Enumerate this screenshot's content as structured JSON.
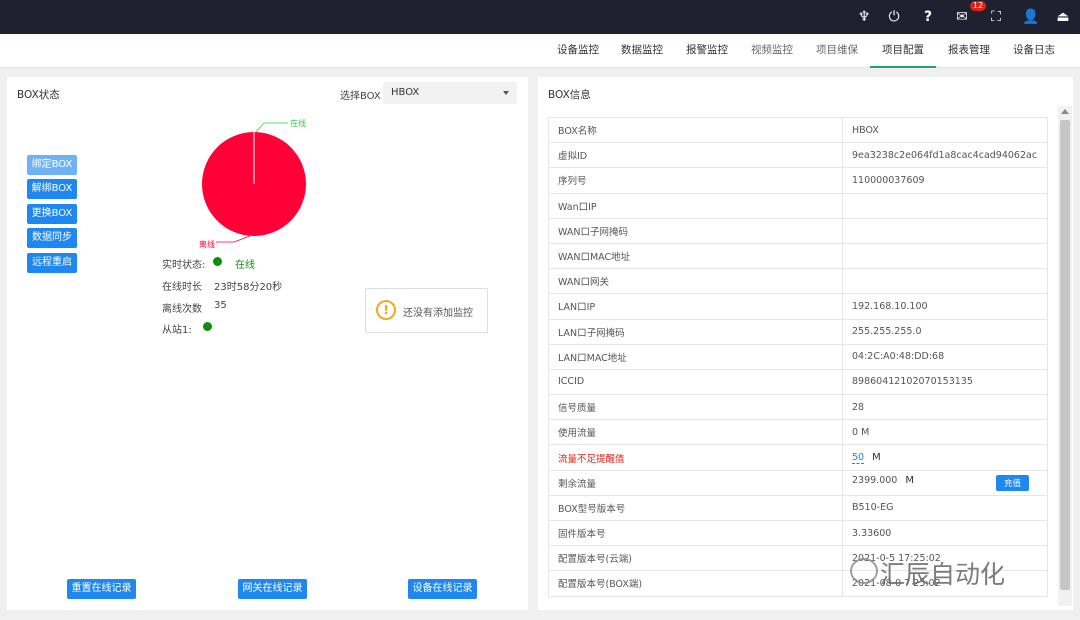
{
  "topbar": {
    "icons": [
      "monitor-alarm-icon",
      "power-icon",
      "help-icon",
      "mail-icon",
      "fullscreen-icon",
      "user-icon",
      "logout-icon"
    ],
    "mail_badge": "12"
  },
  "nav": {
    "items": [
      {
        "label": "设备监控"
      },
      {
        "label": "数据监控"
      },
      {
        "label": "报警监控"
      },
      {
        "label": "视频监控"
      },
      {
        "label": "项目维保"
      },
      {
        "label": "项目配置"
      },
      {
        "label": "报表管理"
      },
      {
        "label": "设备日志"
      }
    ],
    "active": "项目配置",
    "active_color": "#1aa56a"
  },
  "left_panel": {
    "title": "BOX状态",
    "select_label": "选择BOX",
    "select_value": "HBOX",
    "actions": [
      "绑定BOX",
      "解绑BOX",
      "更换BOX",
      "数据同步",
      "远程重启"
    ],
    "pie": {
      "online_label": "在线",
      "offline_label": "离线",
      "online_value": 0,
      "offline_value": 1,
      "online_color": "#2ecc40",
      "offline_color": "#ff0037"
    },
    "status": {
      "realtime_label": "实时状态:",
      "realtime_value": "在线",
      "duration_label": "在线时长",
      "duration_value": "23时58分20秒",
      "offline_count_label": "离线次数",
      "offline_count_value": "35",
      "slave_label": "从站1:"
    },
    "empty_monitor_text": "还没有添加监控",
    "bottom_buttons": [
      "重置在线记录",
      "网关在线记录",
      "设备在线记录"
    ]
  },
  "right_panel": {
    "title": "BOX信息",
    "rows": [
      {
        "key": "BOX名称",
        "value": "HBOX"
      },
      {
        "key": "虚拟ID",
        "value": "9ea3238c2e064fd1a8cac4cad94062ac"
      },
      {
        "key": "序列号",
        "value": "110000037609"
      },
      {
        "key": "Wan口IP",
        "value": ""
      },
      {
        "key": "WAN口子网掩码",
        "value": ""
      },
      {
        "key": "WAN口MAC地址",
        "value": ""
      },
      {
        "key": "WAN口网关",
        "value": ""
      },
      {
        "key": "LAN口IP",
        "value": "192.168.10.100"
      },
      {
        "key": "LAN口子网掩码",
        "value": "255.255.255.0"
      },
      {
        "key": "LAN口MAC地址",
        "value": "04:2C:A0:48:DD:68"
      },
      {
        "key": "ICCID",
        "value": "89860412102070153135"
      },
      {
        "key": "信号质量",
        "value": "28"
      },
      {
        "key": "使用流量",
        "value": "0 M"
      },
      {
        "key": "流量不足提醒值",
        "value": "50",
        "unit": "M"
      },
      {
        "key": "剩余流量",
        "value": "2399.000",
        "unit": "M",
        "action": "充值"
      },
      {
        "key": "BOX型号版本号",
        "value": "B510-EG"
      },
      {
        "key": "固件版本号",
        "value": "3.33600"
      },
      {
        "key": "配置版本号(云端)",
        "value": "2021-0-5 17:25:02"
      },
      {
        "key": "配置版本号(BOX端)",
        "value": "2021-08-0 7 25:02"
      }
    ]
  },
  "watermark": "汇辰自动化"
}
